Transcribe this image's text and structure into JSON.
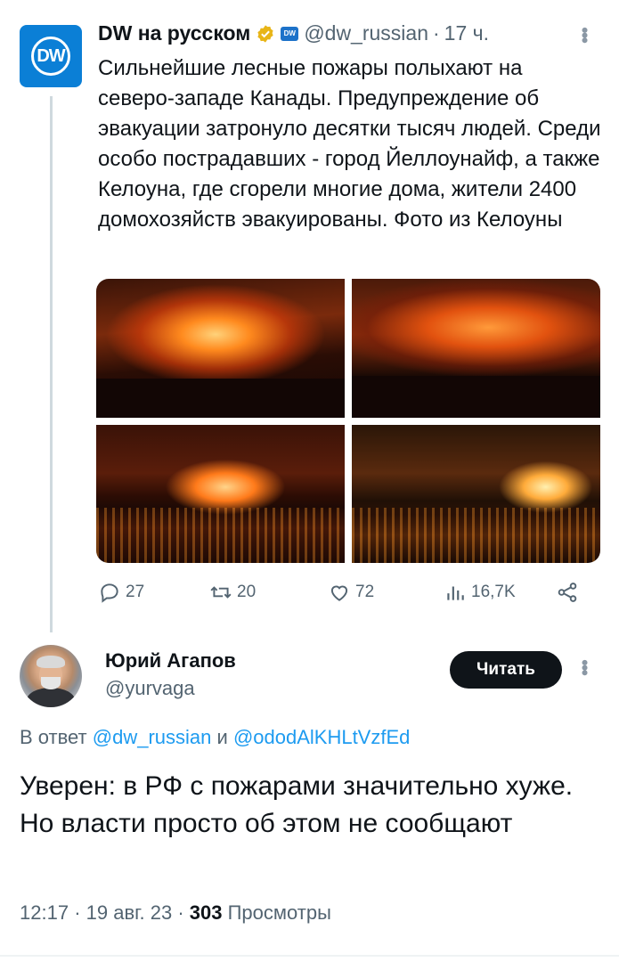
{
  "quoted_tweet": {
    "author_name": "DW на русском",
    "author_logo_text": "DW",
    "handle": "@dw_russian",
    "separator": "·",
    "time": "17 ч.",
    "text": "Сильнейшие лесные пожары полыхают на северо-западе Канады. Предупреждение об эвакуации затронуло десятки тысяч людей. Среди особо пострадавших - город Йеллоунайф, а также Келоуна, где сгорели многие дома, жители 2400 домохозяйств эвакуированы. Фото из Келоуны",
    "photos": [
      "wildfire-photo-1",
      "wildfire-photo-2",
      "wildfire-photo-3",
      "wildfire-photo-4"
    ],
    "stats": {
      "replies": "27",
      "retweets": "20",
      "likes": "72",
      "views": "16,7K"
    }
  },
  "reply_tweet": {
    "author_name": "Юрий Агапов",
    "handle": "@yurvaga",
    "follow_label": "Читать",
    "reply_to_prefix": "В ответ",
    "reply_to_user1": "@dw_russian",
    "reply_to_and": "и",
    "reply_to_user2": "@ododAlKHLtVzfEd",
    "text": "Уверен: в РФ с пожарами значительно хуже. Но власти просто об этом не сообщают",
    "time": "12:17",
    "date": "19 авг. 23",
    "views_count": "303",
    "views_label": "Просмотры"
  },
  "icons": [
    "verified-badge-icon",
    "dw-affiliate-badge-icon",
    "more-options-icon",
    "reply-icon",
    "retweet-icon",
    "like-icon",
    "views-icon",
    "share-icon"
  ],
  "colors": {
    "text": "#0f1419",
    "secondary": "#536471",
    "link": "#1d9bf0",
    "dw_blue": "#0b7fd6",
    "verified_gold": "#e8b517"
  }
}
